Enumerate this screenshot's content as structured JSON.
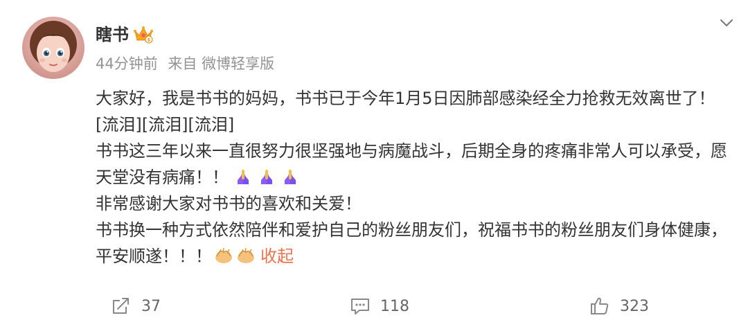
{
  "post": {
    "author": "瞎书",
    "meta": {
      "time": "44分钟前",
      "source": "来自 微博轻享版"
    },
    "paragraphs": {
      "p1": "大家好，我是书书的妈妈，书书已于今年1月5日因肺部感染经全力抢救无效离世了！[流泪][流泪][流泪]",
      "p2": "书书这三年以来一直很努力很坚强地与病魔战斗，后期全身的疼痛非常人可以承受，愿天堂没有病痛！！",
      "p3": "非常感谢大家对书书的喜欢和关爱！",
      "p4": "书书换一种方式依然陪伴和爱护自己的粉丝朋友们，祝福书书的粉丝朋友们身体健康，平安顺遂！！！"
    },
    "collapse_label": "收起",
    "actions": {
      "share_count": "37",
      "comment_count": "118",
      "like_count": "323"
    }
  },
  "icons": {
    "vip": "crown-vip-badge-icon",
    "more": "chevron-down-icon",
    "pray": "folded-hands-emoji-icon",
    "clap": "clapping-hands-emoji-icon",
    "share": "share-icon",
    "comment": "comment-icon",
    "like": "thumbs-up-icon"
  },
  "colors": {
    "text": "#333333",
    "meta": "#939393",
    "link": "#eb7350",
    "action": "#666666",
    "vip_gold": "#f5a623",
    "pray_purple": "#8b5cf6"
  }
}
